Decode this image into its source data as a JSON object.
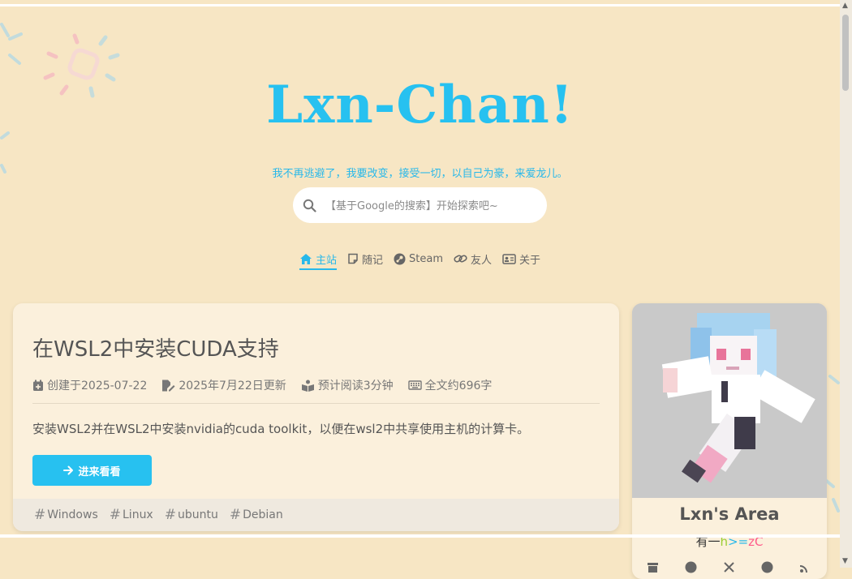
{
  "site": {
    "title": "Lxn-Chan!",
    "slogan": "我不再逃避了，我要改变，接受一切，以自己为豪，来爱龙儿。"
  },
  "search": {
    "placeholder": "【基于Google的搜索】开始探索吧~"
  },
  "nav": [
    {
      "label": "主站",
      "icon": "home-icon",
      "active": true
    },
    {
      "label": "随记",
      "icon": "note-icon"
    },
    {
      "label": "Steam",
      "icon": "steam-icon"
    },
    {
      "label": "友人",
      "icon": "link-icon"
    },
    {
      "label": "关于",
      "icon": "id-card-icon"
    }
  ],
  "post": {
    "title": "在WSL2中安装CUDA支持",
    "meta": {
      "created": "创建于2025-07-22",
      "updated": "2025年7月22日更新",
      "read_time": "预计阅读3分钟",
      "word_count": "全文约696字"
    },
    "excerpt": "安装WSL2并在WSL2中安装nvidia的cuda toolkit，以便在wsl2中共享使用主机的计算卡。",
    "button_label": "进来看看",
    "tags": [
      "Windows",
      "Linux",
      "ubuntu",
      "Debian"
    ]
  },
  "profile": {
    "name": "Lxn's Area",
    "subtitle_prefix": "有一",
    "subtitle_h": "h",
    "subtitle_arrow": ">=",
    "subtitle_zc": "zC",
    "socials": [
      "archive-icon",
      "github-icon",
      "x-icon",
      "steam-icon",
      "rss-icon"
    ]
  },
  "colors": {
    "accent": "#27c1f0",
    "background": "#f7e6c4",
    "card": "#fbf0dc"
  }
}
